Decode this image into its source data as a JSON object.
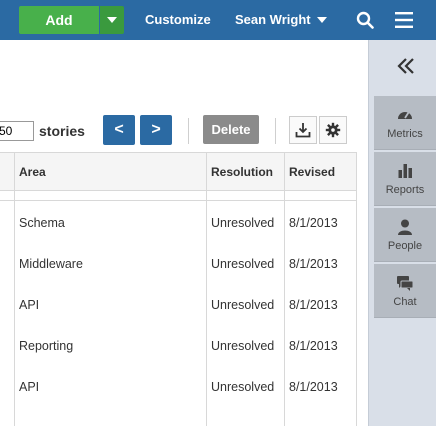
{
  "header": {
    "add_label": "Add",
    "customize_label": "Customize",
    "user_name": "Sean Wright"
  },
  "toolbar": {
    "page_size": "50",
    "stories_label": "stories",
    "prev_label": "<",
    "next_label": ">",
    "delete_label": "Delete"
  },
  "table": {
    "columns": [
      "Area",
      "Resolution",
      "Revised"
    ],
    "rows": [
      {
        "area": "Schema",
        "resolution": "Unresolved",
        "revised": "8/1/2013"
      },
      {
        "area": "Middleware",
        "resolution": "Unresolved",
        "revised": "8/1/2013"
      },
      {
        "area": "API",
        "resolution": "Unresolved",
        "revised": "8/1/2013"
      },
      {
        "area": "Reporting",
        "resolution": "Unresolved",
        "revised": "8/1/2013"
      },
      {
        "area": "API",
        "resolution": "Unresolved",
        "revised": "8/1/2013"
      }
    ]
  },
  "sidebar": {
    "items": [
      {
        "label": "Metrics",
        "icon": "gauge-icon"
      },
      {
        "label": "Reports",
        "icon": "bar-chart-icon"
      },
      {
        "label": "People",
        "icon": "person-icon"
      },
      {
        "label": "Chat",
        "icon": "chat-icon"
      }
    ]
  },
  "colors": {
    "topbar": "#2b6aa3",
    "add_button": "#48b04b",
    "delete_button": "#8b8b8b",
    "sidebar_bg": "#d9dfe8",
    "sidebar_item": "#b6bcc4"
  }
}
